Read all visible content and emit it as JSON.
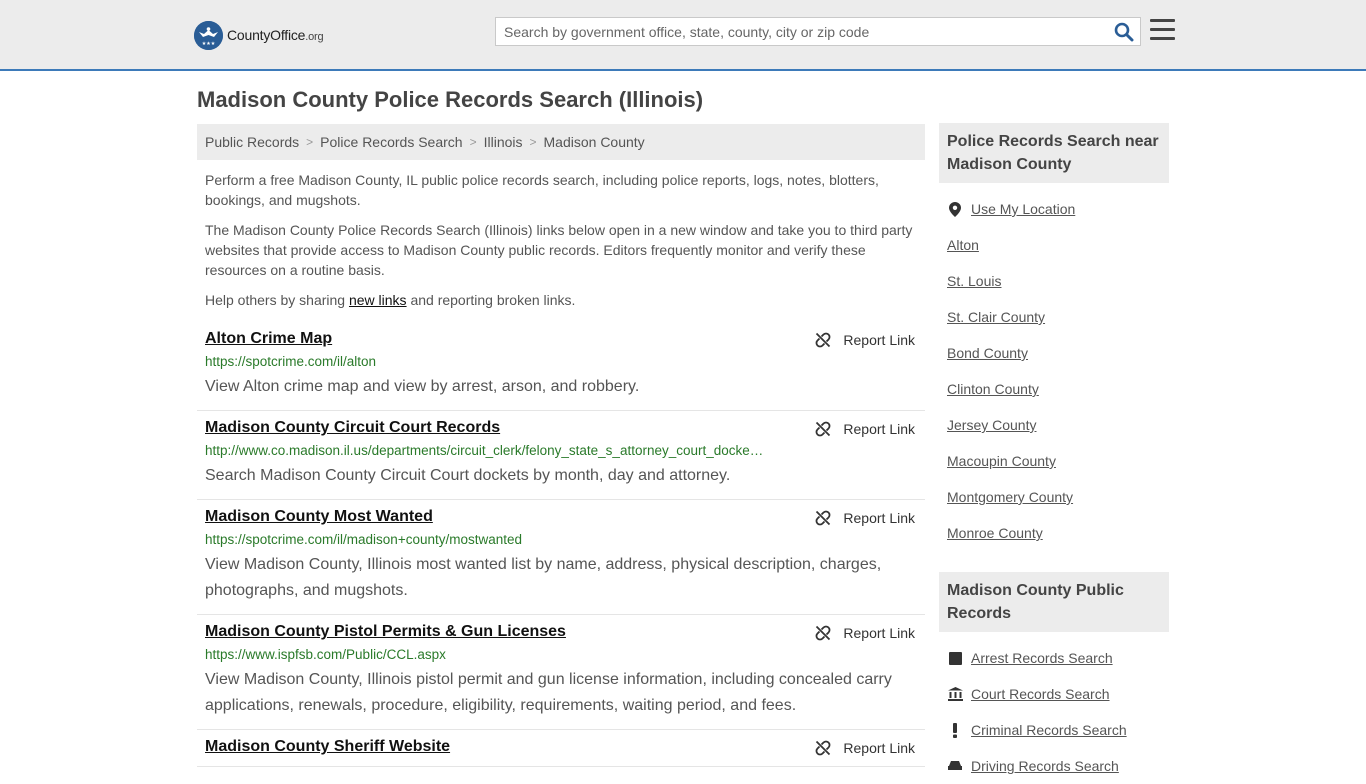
{
  "header": {
    "logo_main": "CountyOffice",
    "logo_tld": ".org",
    "search_placeholder": "Search by government office, state, county, city or zip code"
  },
  "page_title": "Madison County Police Records Search (Illinois)",
  "breadcrumb": [
    "Public Records",
    "Police Records Search",
    "Illinois",
    "Madison County"
  ],
  "intro": {
    "p1": "Perform a free Madison County, IL public police records search, including police reports, logs, notes, blotters, bookings, and mugshots.",
    "p2": "The Madison County Police Records Search (Illinois) links below open in a new window and take you to third party websites that provide access to Madison County public records. Editors frequently monitor and verify these resources on a routine basis.",
    "p3_before": "Help others by sharing ",
    "p3_link": "new links",
    "p3_after": " and reporting broken links."
  },
  "report_label": "Report Link",
  "links": [
    {
      "title": "Alton Crime Map",
      "url": "https://spotcrime.com/il/alton",
      "desc": "View Alton crime map and view by arrest, arson, and robbery."
    },
    {
      "title": "Madison County Circuit Court Records",
      "url": "http://www.co.madison.il.us/departments/circuit_clerk/felony_state_s_attorney_court_docke…",
      "desc": "Search Madison County Circuit Court dockets by month, day and attorney."
    },
    {
      "title": "Madison County Most Wanted",
      "url": "https://spotcrime.com/il/madison+county/mostwanted",
      "desc": "View Madison County, Illinois most wanted list by name, address, physical description, charges, photographs, and mugshots."
    },
    {
      "title": "Madison County Pistol Permits & Gun Licenses",
      "url": "https://www.ispfsb.com/Public/CCL.aspx",
      "desc": "View Madison County, Illinois pistol permit and gun license information, including concealed carry applications, renewals, procedure, eligibility, requirements, waiting period, and fees."
    },
    {
      "title": "Madison County Sheriff Website",
      "url": "",
      "desc": ""
    }
  ],
  "sidebar": {
    "nearby_title": "Police Records Search near Madison County",
    "use_location": "Use My Location",
    "nearby": [
      "Alton",
      "St. Louis",
      "St. Clair County",
      "Bond County",
      "Clinton County",
      "Jersey County",
      "Macoupin County",
      "Montgomery County",
      "Monroe County"
    ],
    "public_title": "Madison County Public Records",
    "public": [
      {
        "label": "Arrest Records Search",
        "icon": "square-icon"
      },
      {
        "label": "Court Records Search",
        "icon": "courthouse-icon"
      },
      {
        "label": "Criminal Records Search",
        "icon": "exclamation-icon"
      },
      {
        "label": "Driving Records Search",
        "icon": "car-icon"
      }
    ]
  },
  "colors": {
    "accent": "#3d7ab9",
    "url_green": "#2a7a2a",
    "panel": "#ececec"
  }
}
